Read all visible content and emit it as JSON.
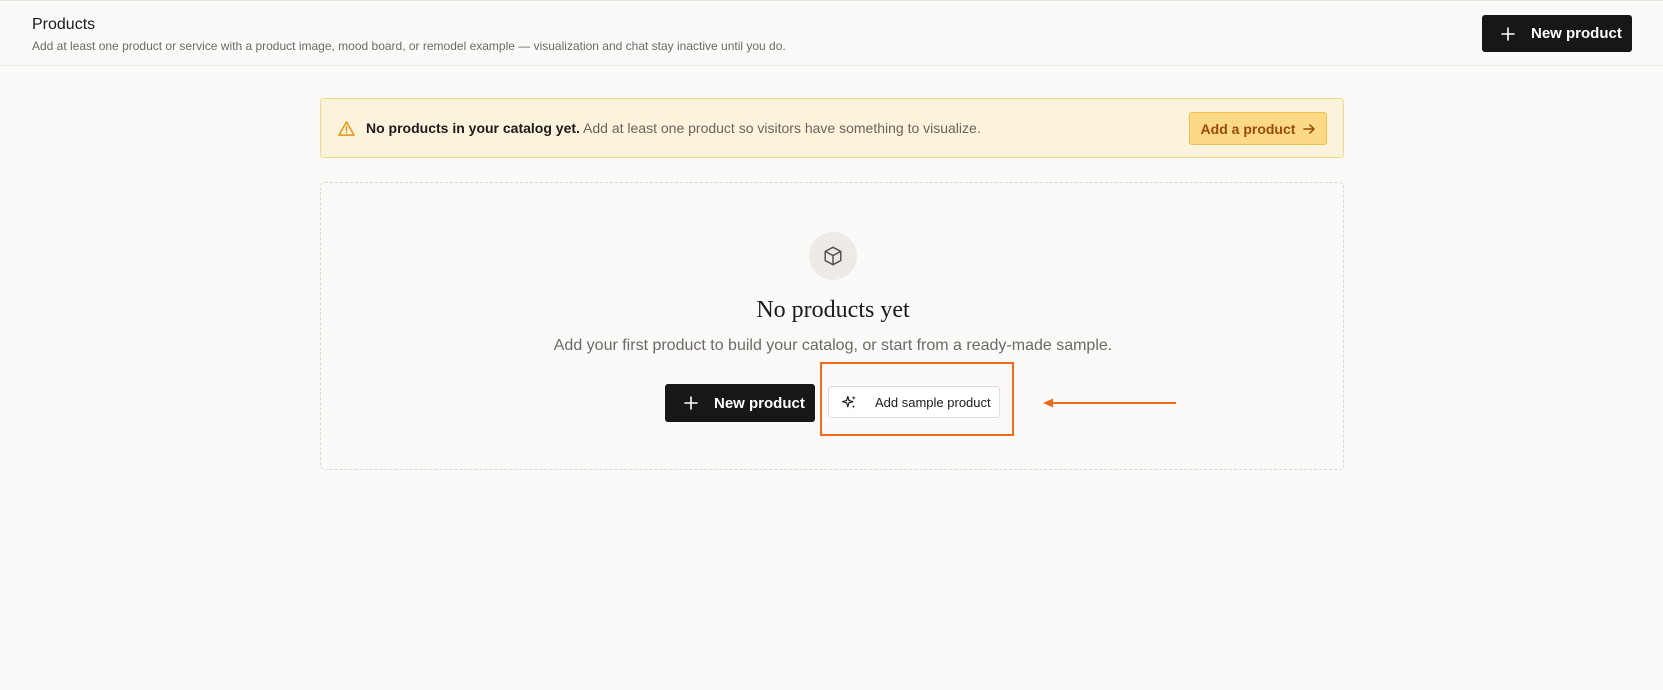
{
  "header": {
    "title": "Products",
    "subtitle": "Add at least one product or service with a product image, mood board, or remodel example — visualization and chat stay inactive until you do.",
    "new_button": "New product"
  },
  "alert": {
    "icon": "warning-triangle-icon",
    "strong_text": "No products in your catalog yet.",
    "text": "Add at least one product so visitors have something to visualize.",
    "button": "Add a product",
    "colors": {
      "background": "#fcf3dd",
      "border": "#f1d98c",
      "button_bg": "#fbd985",
      "button_text": "#9a4a06"
    }
  },
  "empty_state": {
    "icon": "box-icon",
    "title": "No products yet",
    "description": "Add your first product to build your catalog, or start from a ready-made sample.",
    "primary_button": "New product",
    "secondary_button": "Add sample product"
  },
  "annotation": {
    "color": "#f06a1c"
  }
}
